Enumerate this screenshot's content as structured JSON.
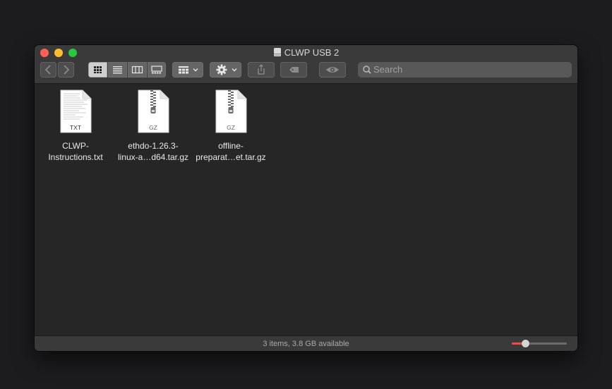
{
  "window": {
    "title": "CLWP USB 2"
  },
  "toolbar": {
    "back": "back-icon",
    "forward": "forward-icon",
    "view_modes": [
      "icon-view-icon",
      "list-view-icon",
      "column-view-icon",
      "gallery-view-icon"
    ],
    "selected_view": "icon-view-icon",
    "group_by": "group-by-icon",
    "action": "gear-icon",
    "share": "share-icon",
    "tags": "tag-icon",
    "quick_look": "eye-icon",
    "search": {
      "placeholder": "Search"
    }
  },
  "files": [
    {
      "name": "CLWP-\nInstructions.txt",
      "type": "TXT"
    },
    {
      "name": "ethdo-1.26.3-\nlinux-a…d64.tar.gz",
      "type": "GZ"
    },
    {
      "name": "offline-\npreparat…et.tar.gz",
      "type": "GZ"
    }
  ],
  "status": {
    "text": "3 items, 3.8 GB available"
  },
  "icon_size_slider": {
    "value": 0.25
  },
  "colors": {
    "close": "#fe5f57",
    "minimize": "#febc2e",
    "maximize": "#28c840",
    "slider_fill": "#ee4d4d"
  }
}
